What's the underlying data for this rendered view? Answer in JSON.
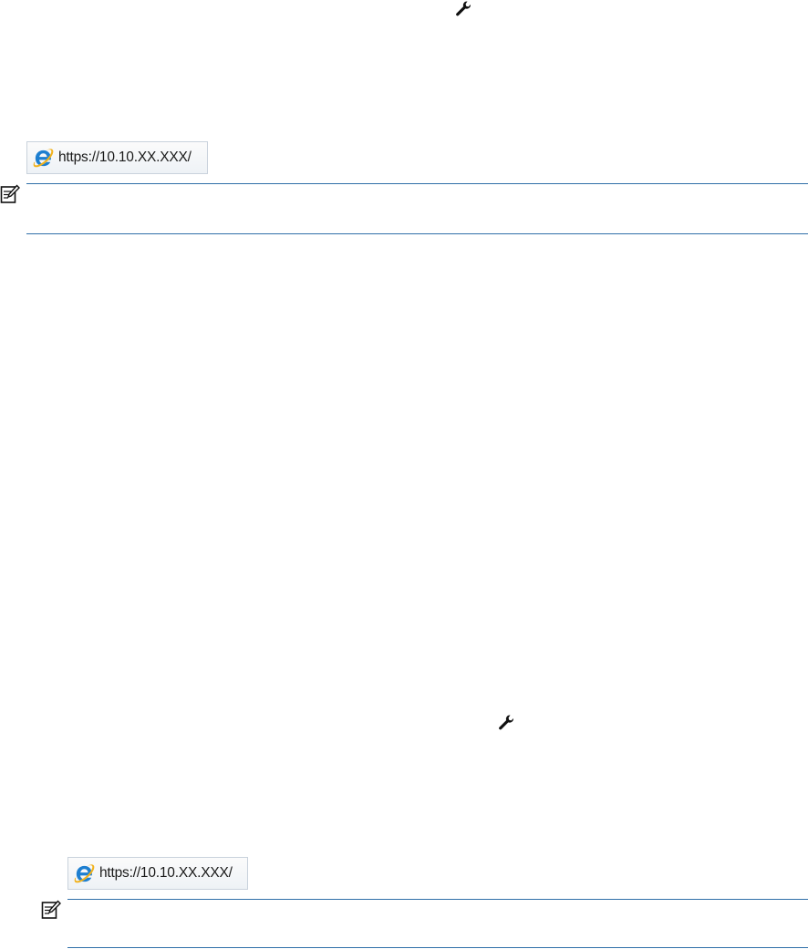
{
  "block1": {
    "icon": "wrench-icon",
    "address_bar": {
      "browser_icon": "internet-explorer-icon",
      "url": "https://10.10.XX.XXX/"
    },
    "note": {
      "icon": "note-icon",
      "text": ""
    }
  },
  "block2": {
    "icon": "wrench-icon",
    "address_bar": {
      "browser_icon": "internet-explorer-icon",
      "url": "https://10.10.XX.XXX/"
    },
    "note": {
      "icon": "note-icon",
      "text": ""
    }
  },
  "colors": {
    "rule": "#2f6fa8",
    "ie_blue": "#1e7fd0",
    "ie_ring": "#f2b21b"
  }
}
